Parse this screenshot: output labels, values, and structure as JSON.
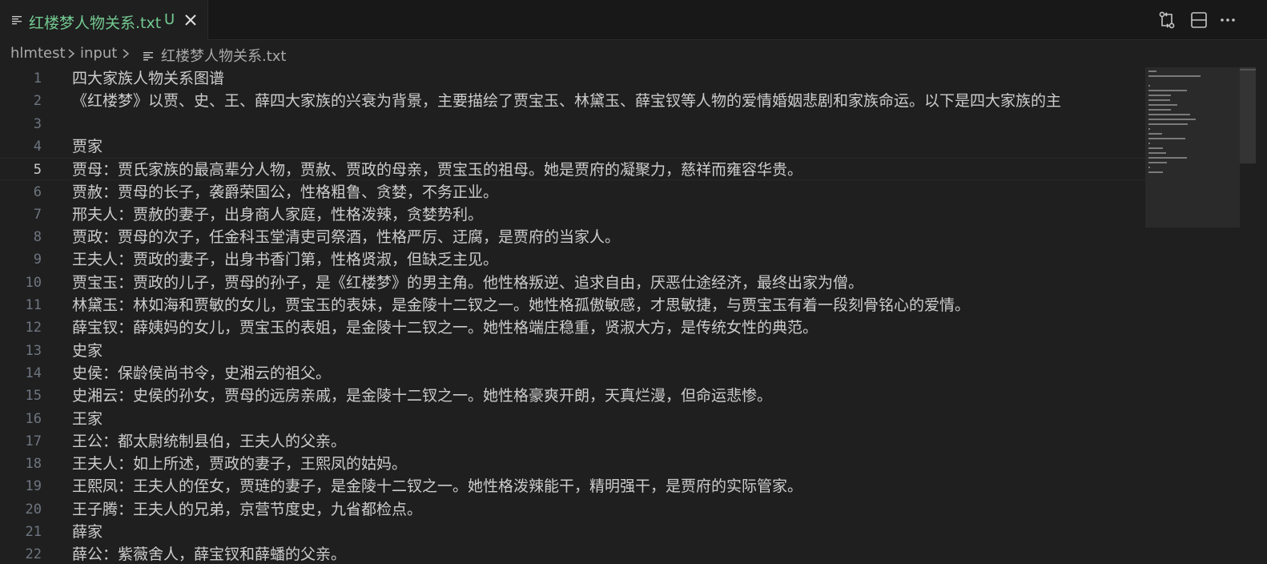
{
  "tab": {
    "title": "红楼梦人物关系.txt",
    "status": "U"
  },
  "breadcrumb": {
    "root": "hlmtest",
    "folder": "input",
    "file": "红楼梦人物关系.txt"
  },
  "editor": {
    "current_line": 5,
    "lines": [
      {
        "n": "1",
        "text": "四大家族人物关系图谱"
      },
      {
        "n": "2",
        "text": "《红楼梦》以贾、史、王、薛四大家族的兴衰为背景，主要描绘了贾宝玉、林黛玉、薛宝钗等人物的爱情婚姻悲剧和家族命运。以下是四大家族的主"
      },
      {
        "n": "3",
        "text": ""
      },
      {
        "n": "4",
        "text": "贾家"
      },
      {
        "n": "5",
        "text": "贾母：贾氏家族的最高辈分人物，贾赦、贾政的母亲，贾宝玉的祖母。她是贾府的凝聚力，慈祥而雍容华贵。"
      },
      {
        "n": "6",
        "text": "贾赦：贾母的长子，袭爵荣国公，性格粗鲁、贪婪，不务正业。"
      },
      {
        "n": "7",
        "text": "邢夫人：贾赦的妻子，出身商人家庭，性格泼辣，贪婪势利。"
      },
      {
        "n": "8",
        "text": "贾政：贾母的次子，任金科玉堂清吏司祭酒，性格严厉、迂腐，是贾府的当家人。"
      },
      {
        "n": "9",
        "text": "王夫人：贾政的妻子，出身书香门第，性格贤淑，但缺乏主见。"
      },
      {
        "n": "10",
        "text": "贾宝玉：贾政的儿子，贾母的孙子，是《红楼梦》的男主角。他性格叛逆、追求自由，厌恶仕途经济，最终出家为僧。"
      },
      {
        "n": "11",
        "text": "林黛玉：林如海和贾敏的女儿，贾宝玉的表妹，是金陵十二钗之一。她性格孤傲敏感，才思敏捷，与贾宝玉有着一段刻骨铭心的爱情。"
      },
      {
        "n": "12",
        "text": "薛宝钗：薛姨妈的女儿，贾宝玉的表姐，是金陵十二钗之一。她性格端庄稳重，贤淑大方，是传统女性的典范。"
      },
      {
        "n": "13",
        "text": "史家"
      },
      {
        "n": "14",
        "text": "史侯：保龄侯尚书令，史湘云的祖父。"
      },
      {
        "n": "15",
        "text": "史湘云：史侯的孙女，贾母的远房亲戚，是金陵十二钗之一。她性格豪爽开朗，天真烂漫，但命运悲惨。"
      },
      {
        "n": "16",
        "text": "王家"
      },
      {
        "n": "17",
        "text": "王公：都太尉统制县伯，王夫人的父亲。"
      },
      {
        "n": "18",
        "text": "王夫人：如上所述，贾政的妻子，王熙凤的姑妈。"
      },
      {
        "n": "19",
        "text": "王熙凤：王夫人的侄女，贾琏的妻子，是金陵十二钗之一。她性格泼辣能干，精明强干，是贾府的实际管家。"
      },
      {
        "n": "20",
        "text": "王子腾：王夫人的兄弟，京营节度史，九省都检点。"
      },
      {
        "n": "21",
        "text": "薛家"
      },
      {
        "n": "22",
        "text": "薛公：紫薇舍人，薛宝钗和薛蟠的父亲。"
      }
    ]
  },
  "icons": {
    "tab_file": "file-lines-icon",
    "close": "close-icon",
    "compare_changes": "compare-changes-icon",
    "split_editor": "split-editor-icon",
    "more_actions": "more-actions-icon"
  },
  "colors": {
    "modified": "#73c991",
    "background": "#1f1f1f",
    "line_number": "#6e7681"
  }
}
